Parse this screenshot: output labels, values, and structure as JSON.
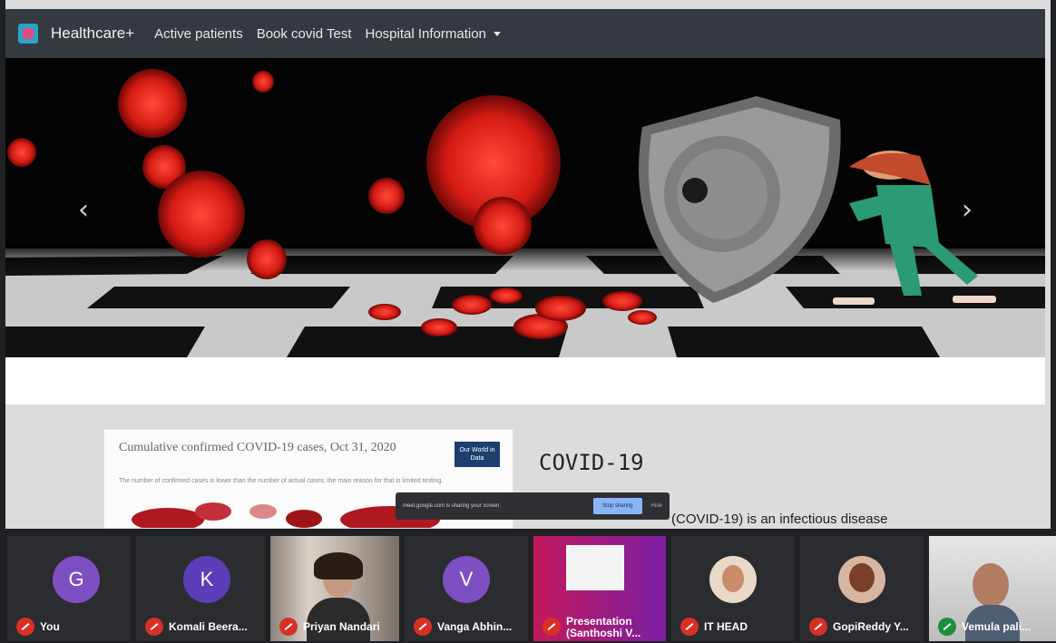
{
  "navbar": {
    "brand": "Healthcare+",
    "links": [
      "Active patients",
      "Book covid Test",
      "Hospital Information"
    ]
  },
  "carousel": {
    "prev": "‹",
    "next": "›"
  },
  "map_card": {
    "title": "Cumulative confirmed COVID-19 cases, Oct 31, 2020",
    "subtitle": "The number of confirmed cases is lower than the number of actual cases; the main reason for that is limited testing.",
    "badge": "Our World in Data"
  },
  "covid": {
    "heading": "COVID-19",
    "body": "(COVID-19) is an infectious disease"
  },
  "share_bar": {
    "text": "meet.google.com is sharing your screen.",
    "stop_label": "Stop sharing",
    "hide_label": "Hide"
  },
  "participants": [
    {
      "initial": "G",
      "name": "You",
      "color": "#7d4fc3"
    },
    {
      "initial": "K",
      "name": "Komali Beera...",
      "color": "#5b3db8"
    },
    {
      "initial": "",
      "name": "Priyan Nandari",
      "color": ""
    },
    {
      "initial": "V",
      "name": "Vanga Abhin...",
      "color": "#7d4fc3"
    },
    {
      "initial": "",
      "name": "Presentation (Santhoshi V...",
      "color": ""
    },
    {
      "initial": "",
      "name": "IT HEAD",
      "color": ""
    },
    {
      "initial": "",
      "name": "GopiReddy Y...",
      "color": ""
    },
    {
      "initial": "",
      "name": "Vemula pali...",
      "color": ""
    }
  ],
  "colors": {
    "navbar": "#343a40",
    "virus": "#e0231c",
    "mic_off": "#d93025",
    "meet_bg": "#202124"
  }
}
